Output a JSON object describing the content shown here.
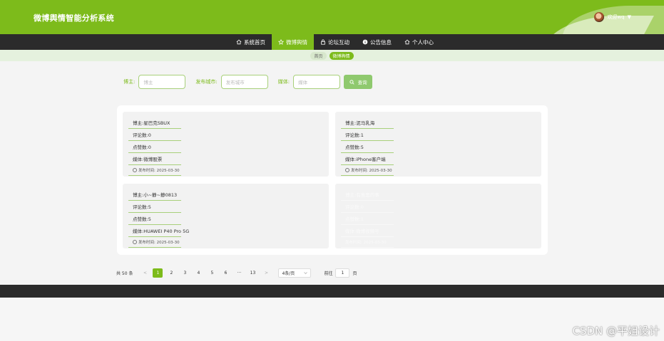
{
  "header": {
    "app_title": "微博舆情智能分析系统",
    "welcome": "欢迎wq",
    "caret": "▼"
  },
  "nav": {
    "items": [
      {
        "label": "系统首页",
        "icon": "home-icon",
        "active": false
      },
      {
        "label": "微博舆情",
        "icon": "star-icon",
        "active": true
      },
      {
        "label": "论坛互动",
        "icon": "lock-icon",
        "active": false
      },
      {
        "label": "公告信息",
        "icon": "info-icon",
        "active": false
      },
      {
        "label": "个人中心",
        "icon": "home-icon",
        "active": false
      }
    ]
  },
  "breadcrumb": {
    "home": "首页",
    "current": "微博舆情"
  },
  "filters": {
    "blogger_label": "博主:",
    "blogger_placeholder": "博主",
    "city_label": "发布城市:",
    "city_placeholder": "发布城市",
    "media_label": "媒体:",
    "media_placeholder": "媒体",
    "search_label": "查询"
  },
  "cards": [
    {
      "blogger": "博主:星巴克SBUX",
      "comments": "评论数:0",
      "likes": "点赞数:0",
      "media": "媒体:微博股票",
      "time": "发布时间:  2025-03-30"
    },
    {
      "blogger": "博主:泥马乳海",
      "comments": "评论数:1",
      "likes": "点赞数:5",
      "media": "媒体:iPhone客户端",
      "time": "发布时间:  2025-03-30"
    },
    {
      "blogger": "博主:小~静~静0813",
      "comments": "评论数:5",
      "likes": "点赞数:5",
      "media": "媒体:HUAWEI P40 Pro 5G",
      "time": "发布时间:  2025-03-30"
    },
    {
      "blogger": "博主:有意思的事",
      "comments": "评论数:0",
      "likes": "点赞数:1",
      "media": "媒体:微博视频号",
      "time": "发布时间:  2025-03-30"
    }
  ],
  "pagination": {
    "total": "共 50 条",
    "prev": "<",
    "pages": [
      "1",
      "2",
      "3",
      "4",
      "5",
      "6",
      "···",
      "13"
    ],
    "active_page": "1",
    "next": ">",
    "page_size": "4条/页",
    "goto_label": "前往",
    "goto_value": "1",
    "goto_suffix": "页"
  },
  "watermark": "CSDN @平姐设计",
  "colors": {
    "brand_green": "#7dbb1b",
    "nav_dark": "#2b2b2b",
    "crumb_bg": "#e5f1de"
  }
}
